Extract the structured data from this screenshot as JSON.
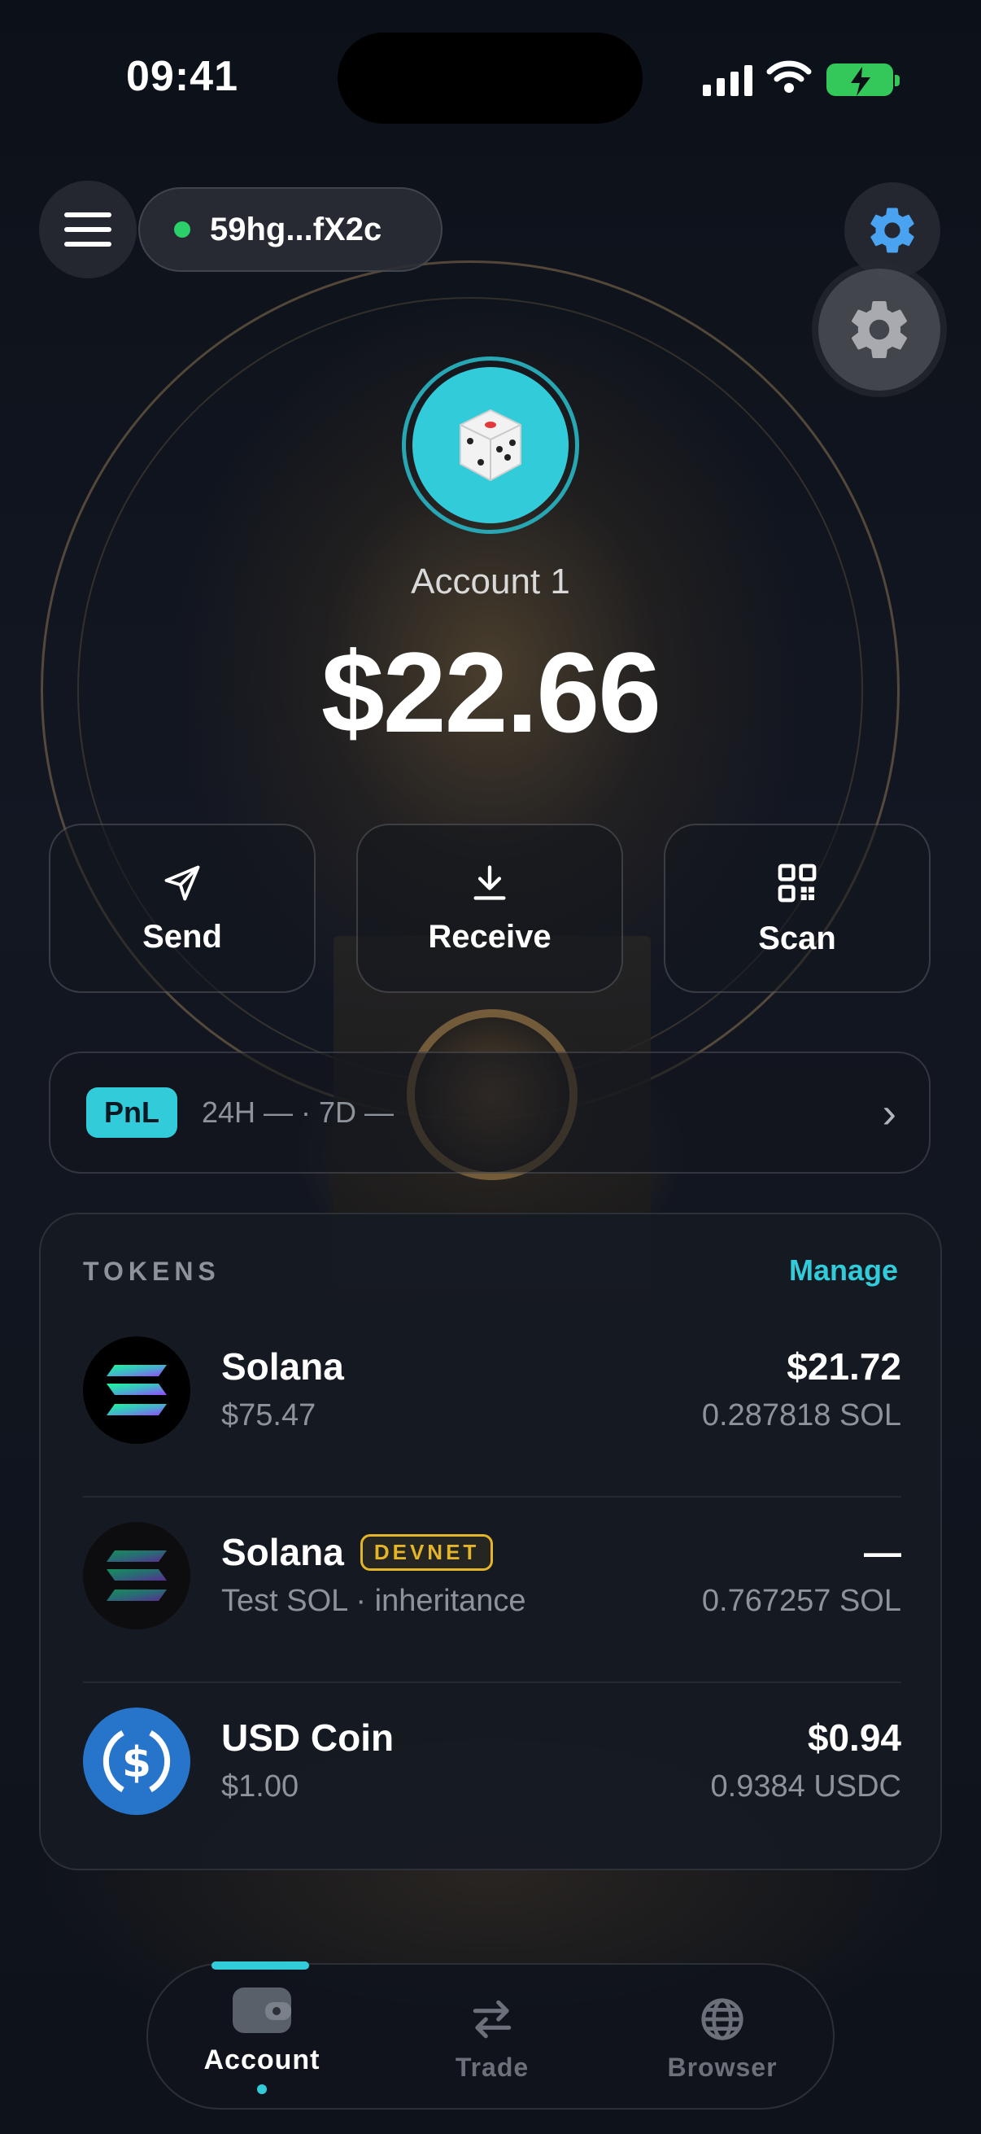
{
  "status_bar": {
    "time": "09:41"
  },
  "header": {
    "wallet_address": "59hg...fX2c"
  },
  "account": {
    "name": "Account 1",
    "balance": "$22.66"
  },
  "actions": [
    {
      "label": "Send",
      "icon": "send-icon"
    },
    {
      "label": "Receive",
      "icon": "download-icon"
    },
    {
      "label": "Scan",
      "icon": "qr-code-icon"
    }
  ],
  "pnl": {
    "badge": "PnL",
    "summary": "24H — · 7D —"
  },
  "tokens": {
    "title": "TOKENS",
    "manage_label": "Manage",
    "items": [
      {
        "name": "Solana",
        "badge": "",
        "sub": "$75.47",
        "value": "$21.72",
        "amount": "0.287818 SOL"
      },
      {
        "name": "Solana",
        "badge": "DEVNET",
        "sub": "Test SOL · inheritance",
        "value": "—",
        "amount": "0.767257 SOL"
      },
      {
        "name": "USD Coin",
        "badge": "",
        "sub": "$1.00",
        "value": "$0.94",
        "amount": "0.9384 USDC"
      }
    ]
  },
  "nav": {
    "items": [
      {
        "label": "Account",
        "icon": "wallet-icon",
        "active": true
      },
      {
        "label": "Trade",
        "icon": "swap-arrows-icon",
        "active": false
      },
      {
        "label": "Browser",
        "icon": "globe-icon",
        "active": false
      }
    ]
  },
  "colors": {
    "accent": "#32cbd9",
    "devnet": "#e4b429",
    "online": "#2bd06b",
    "usdc": "#2775ca"
  }
}
